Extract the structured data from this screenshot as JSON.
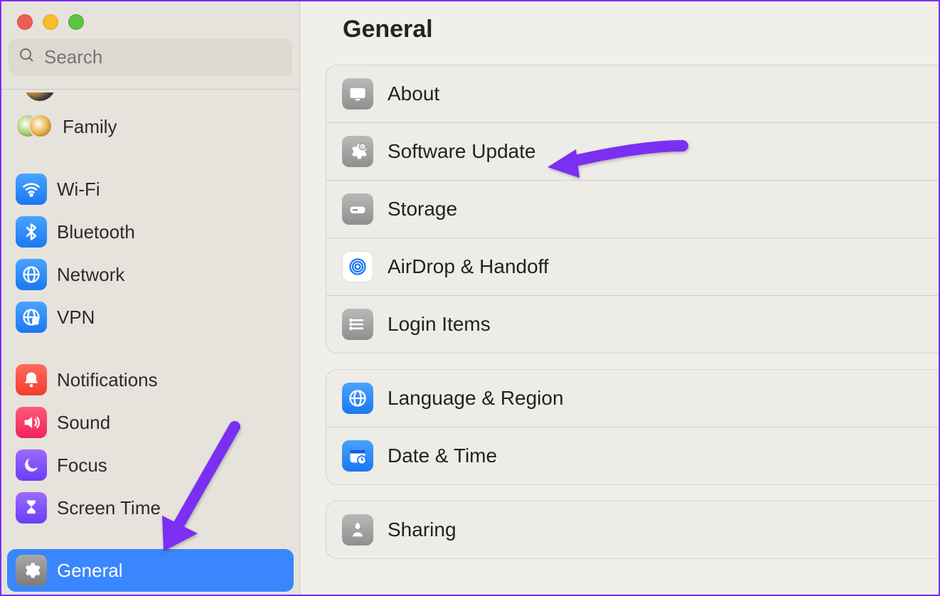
{
  "window": {
    "title": "General"
  },
  "search": {
    "placeholder": "Search"
  },
  "sidebar": {
    "family_label": "Family",
    "items_net": [
      {
        "label": "Wi-Fi"
      },
      {
        "label": "Bluetooth"
      },
      {
        "label": "Network"
      },
      {
        "label": "VPN"
      }
    ],
    "items_sys": [
      {
        "label": "Notifications"
      },
      {
        "label": "Sound"
      },
      {
        "label": "Focus"
      },
      {
        "label": "Screen Time"
      }
    ],
    "items_general": [
      {
        "label": "General"
      }
    ]
  },
  "main": {
    "group1": [
      {
        "label": "About"
      },
      {
        "label": "Software Update"
      },
      {
        "label": "Storage"
      },
      {
        "label": "AirDrop & Handoff"
      },
      {
        "label": "Login Items"
      }
    ],
    "group2": [
      {
        "label": "Language & Region"
      },
      {
        "label": "Date & Time"
      }
    ],
    "group3": [
      {
        "label": "Sharing"
      }
    ]
  },
  "colors": {
    "accent": "#7b2ff2"
  }
}
